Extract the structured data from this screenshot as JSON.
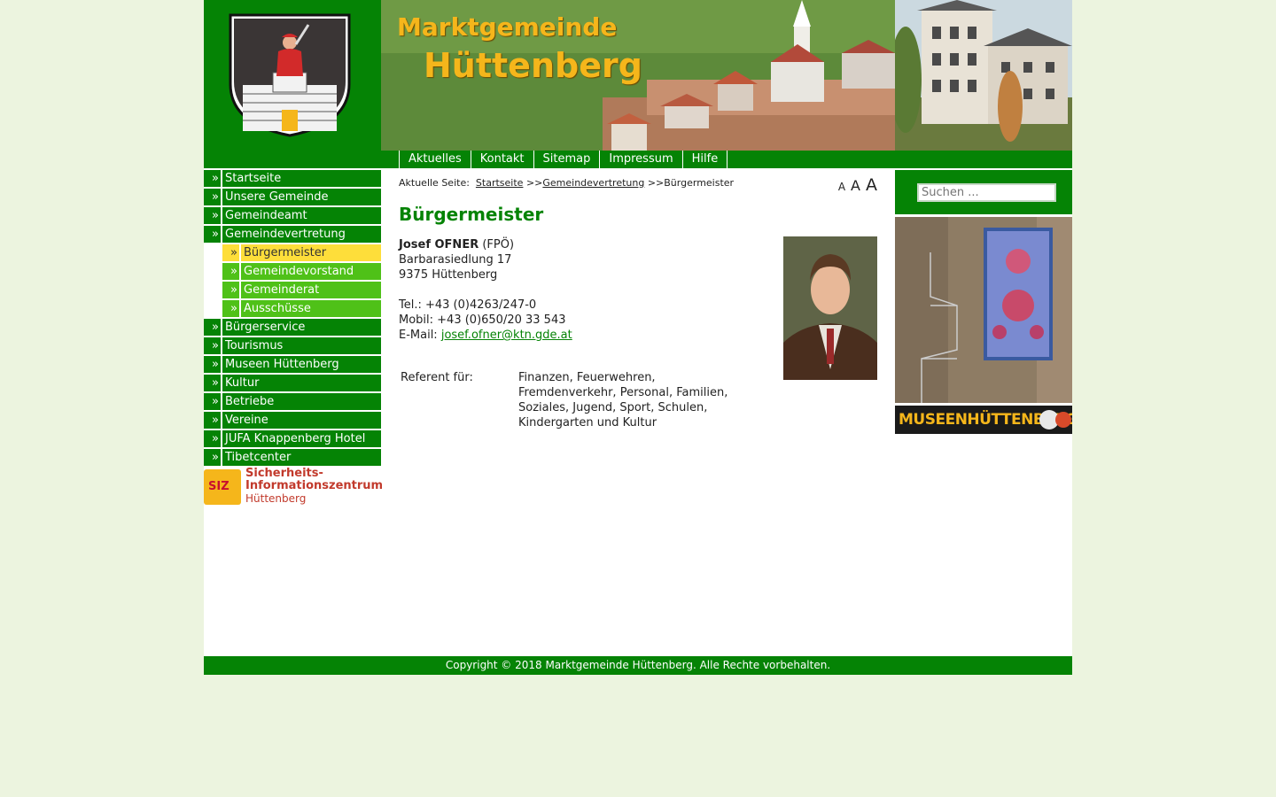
{
  "header": {
    "title_line1": "Marktgemeinde",
    "title_line2": "Hüttenberg"
  },
  "topnav": [
    {
      "label": "Aktuelles"
    },
    {
      "label": "Kontakt"
    },
    {
      "label": "Sitemap"
    },
    {
      "label": "Impressum"
    },
    {
      "label": "Hilfe"
    }
  ],
  "sidebar": {
    "items": [
      {
        "label": "Startseite"
      },
      {
        "label": "Unsere Gemeinde"
      },
      {
        "label": "Gemeindeamt"
      },
      {
        "label": "Gemeindevertretung"
      }
    ],
    "subitems": [
      {
        "label": "Bürgermeister"
      },
      {
        "label": "Gemeindevorstand"
      },
      {
        "label": "Gemeinderat"
      },
      {
        "label": "Ausschüsse"
      }
    ],
    "items_after": [
      {
        "label": "Bürgerservice"
      },
      {
        "label": "Tourismus"
      },
      {
        "label": "Museen Hüttenberg"
      },
      {
        "label": "Kultur"
      },
      {
        "label": "Betriebe"
      },
      {
        "label": "Vereine"
      },
      {
        "label": "JUFA Knappenberg Hotel"
      },
      {
        "label": "Tibetcenter"
      }
    ],
    "arrow": "»",
    "siz_banner": {
      "logo_text": "SIZ",
      "line1": "Sicherheits-",
      "line2": "Informationszentrum",
      "line3": "Hüttenberg"
    }
  },
  "breadcrumb": {
    "prefix": "Aktuelle Seite:",
    "link1": "Startseite",
    "sep": ">>",
    "link2": "Gemeindevertretung",
    "current": "Bürgermeister"
  },
  "fontsize": {
    "small": "A",
    "medium": "A",
    "large": "A"
  },
  "page_title": "Bürgermeister",
  "contact": {
    "name": "Josef OFNER",
    "party": "(FPÖ)",
    "street": "Barbarasiedlung 17",
    "city": "9375 Hüttenberg",
    "tel": "Tel.: +43 (0)4263/247-0",
    "mobile": "Mobil: +43 (0)650/20 33 543",
    "email_label": "E-Mail:",
    "email": "josef.ofner@ktn.gde.at"
  },
  "referent": {
    "label": "Referent für:",
    "value": "Finanzen, Feuerwehren, Fremdenverkehr, Personal, Familien, Soziales, Jugend, Sport, Schulen, Kindergarten und Kultur"
  },
  "search": {
    "placeholder": "Suchen ..."
  },
  "museen_banner": {
    "text": "MUSEENHÜTTENBERG"
  },
  "footer": {
    "text": "Copyright © 2018 Marktgemeinde Hüttenberg. Alle Rechte vorbehalten."
  },
  "colors": {
    "brand_green": "#058305",
    "sub_green": "#4fc118",
    "active_yellow": "#fede3a",
    "title_gold": "#f5b61b"
  }
}
